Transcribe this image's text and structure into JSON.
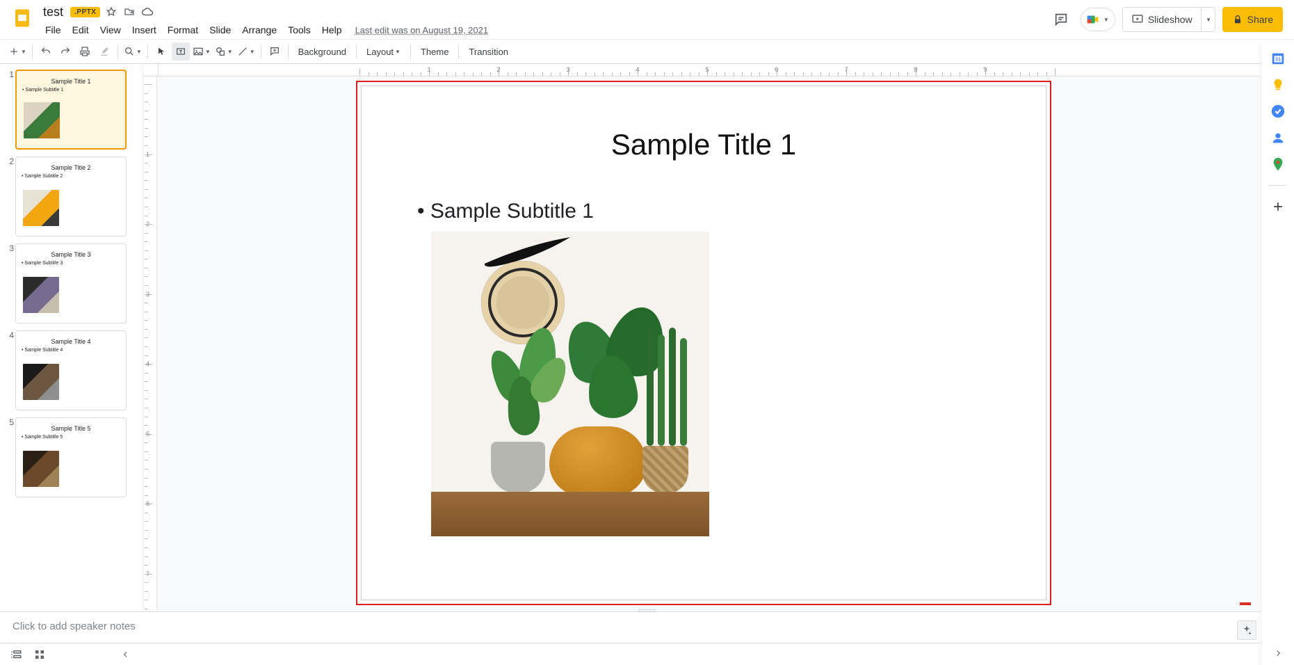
{
  "doc": {
    "name": "test",
    "badge": ".PPTX",
    "last_edit": "Last edit was on August 19, 2021"
  },
  "menus": [
    "File",
    "Edit",
    "View",
    "Insert",
    "Format",
    "Slide",
    "Arrange",
    "Tools",
    "Help"
  ],
  "titlebar_buttons": {
    "slideshow": "Slideshow",
    "share": "Share"
  },
  "toolbar": {
    "background": "Background",
    "layout": "Layout",
    "theme": "Theme",
    "transition": "Transition"
  },
  "slides": [
    {
      "num": "1",
      "title": "Sample Title 1",
      "subtitle": "Sample Subtitle 1",
      "selected": true
    },
    {
      "num": "2",
      "title": "Sample Title 2",
      "subtitle": "Sample Subtitle 2",
      "selected": false
    },
    {
      "num": "3",
      "title": "Sample Title 3",
      "subtitle": "Sample Subtitle 3",
      "selected": false
    },
    {
      "num": "4",
      "title": "Sample Title 4",
      "subtitle": "Sample Subtitle 4",
      "selected": false
    },
    {
      "num": "5",
      "title": "Sample Title 5",
      "subtitle": "Sample Subtitle 5",
      "selected": false
    }
  ],
  "canvas": {
    "title": "Sample Title 1",
    "subtitle": "Sample Subtitle 1"
  },
  "notes_placeholder": "Click to add speaker notes",
  "ruler_h_labels": [
    "1",
    "2",
    "3",
    "4",
    "5",
    "6",
    "7",
    "8",
    "9"
  ],
  "ruler_v_labels": [
    "1",
    "2",
    "3",
    "4",
    "5",
    "6",
    "7"
  ],
  "side_apps": [
    "calendar",
    "keep",
    "tasks",
    "contacts",
    "maps"
  ],
  "colors": {
    "selection_red": "#d91f1f",
    "accent_yellow": "#fbbc04"
  }
}
